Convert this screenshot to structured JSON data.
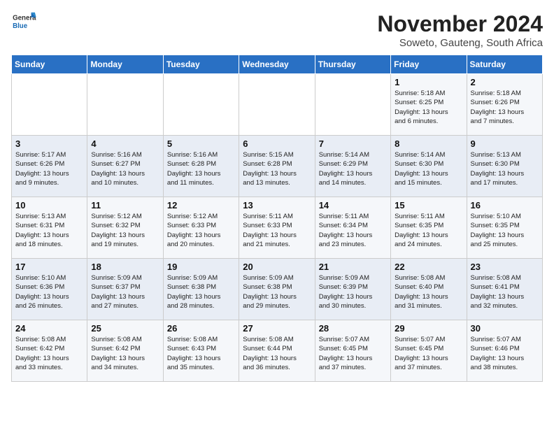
{
  "app": {
    "name": "GeneralBlue",
    "logo_text_1": "General",
    "logo_text_2": "Blue"
  },
  "calendar": {
    "month_title": "November 2024",
    "subtitle": "Soweto, Gauteng, South Africa",
    "days_of_week": [
      "Sunday",
      "Monday",
      "Tuesday",
      "Wednesday",
      "Thursday",
      "Friday",
      "Saturday"
    ],
    "weeks": [
      [
        {
          "day": "",
          "info": ""
        },
        {
          "day": "",
          "info": ""
        },
        {
          "day": "",
          "info": ""
        },
        {
          "day": "",
          "info": ""
        },
        {
          "day": "",
          "info": ""
        },
        {
          "day": "1",
          "info": "Sunrise: 5:18 AM\nSunset: 6:25 PM\nDaylight: 13 hours\nand 6 minutes."
        },
        {
          "day": "2",
          "info": "Sunrise: 5:18 AM\nSunset: 6:26 PM\nDaylight: 13 hours\nand 7 minutes."
        }
      ],
      [
        {
          "day": "3",
          "info": "Sunrise: 5:17 AM\nSunset: 6:26 PM\nDaylight: 13 hours\nand 9 minutes."
        },
        {
          "day": "4",
          "info": "Sunrise: 5:16 AM\nSunset: 6:27 PM\nDaylight: 13 hours\nand 10 minutes."
        },
        {
          "day": "5",
          "info": "Sunrise: 5:16 AM\nSunset: 6:28 PM\nDaylight: 13 hours\nand 11 minutes."
        },
        {
          "day": "6",
          "info": "Sunrise: 5:15 AM\nSunset: 6:28 PM\nDaylight: 13 hours\nand 13 minutes."
        },
        {
          "day": "7",
          "info": "Sunrise: 5:14 AM\nSunset: 6:29 PM\nDaylight: 13 hours\nand 14 minutes."
        },
        {
          "day": "8",
          "info": "Sunrise: 5:14 AM\nSunset: 6:30 PM\nDaylight: 13 hours\nand 15 minutes."
        },
        {
          "day": "9",
          "info": "Sunrise: 5:13 AM\nSunset: 6:30 PM\nDaylight: 13 hours\nand 17 minutes."
        }
      ],
      [
        {
          "day": "10",
          "info": "Sunrise: 5:13 AM\nSunset: 6:31 PM\nDaylight: 13 hours\nand 18 minutes."
        },
        {
          "day": "11",
          "info": "Sunrise: 5:12 AM\nSunset: 6:32 PM\nDaylight: 13 hours\nand 19 minutes."
        },
        {
          "day": "12",
          "info": "Sunrise: 5:12 AM\nSunset: 6:33 PM\nDaylight: 13 hours\nand 20 minutes."
        },
        {
          "day": "13",
          "info": "Sunrise: 5:11 AM\nSunset: 6:33 PM\nDaylight: 13 hours\nand 21 minutes."
        },
        {
          "day": "14",
          "info": "Sunrise: 5:11 AM\nSunset: 6:34 PM\nDaylight: 13 hours\nand 23 minutes."
        },
        {
          "day": "15",
          "info": "Sunrise: 5:11 AM\nSunset: 6:35 PM\nDaylight: 13 hours\nand 24 minutes."
        },
        {
          "day": "16",
          "info": "Sunrise: 5:10 AM\nSunset: 6:35 PM\nDaylight: 13 hours\nand 25 minutes."
        }
      ],
      [
        {
          "day": "17",
          "info": "Sunrise: 5:10 AM\nSunset: 6:36 PM\nDaylight: 13 hours\nand 26 minutes."
        },
        {
          "day": "18",
          "info": "Sunrise: 5:09 AM\nSunset: 6:37 PM\nDaylight: 13 hours\nand 27 minutes."
        },
        {
          "day": "19",
          "info": "Sunrise: 5:09 AM\nSunset: 6:38 PM\nDaylight: 13 hours\nand 28 minutes."
        },
        {
          "day": "20",
          "info": "Sunrise: 5:09 AM\nSunset: 6:38 PM\nDaylight: 13 hours\nand 29 minutes."
        },
        {
          "day": "21",
          "info": "Sunrise: 5:09 AM\nSunset: 6:39 PM\nDaylight: 13 hours\nand 30 minutes."
        },
        {
          "day": "22",
          "info": "Sunrise: 5:08 AM\nSunset: 6:40 PM\nDaylight: 13 hours\nand 31 minutes."
        },
        {
          "day": "23",
          "info": "Sunrise: 5:08 AM\nSunset: 6:41 PM\nDaylight: 13 hours\nand 32 minutes."
        }
      ],
      [
        {
          "day": "24",
          "info": "Sunrise: 5:08 AM\nSunset: 6:42 PM\nDaylight: 13 hours\nand 33 minutes."
        },
        {
          "day": "25",
          "info": "Sunrise: 5:08 AM\nSunset: 6:42 PM\nDaylight: 13 hours\nand 34 minutes."
        },
        {
          "day": "26",
          "info": "Sunrise: 5:08 AM\nSunset: 6:43 PM\nDaylight: 13 hours\nand 35 minutes."
        },
        {
          "day": "27",
          "info": "Sunrise: 5:08 AM\nSunset: 6:44 PM\nDaylight: 13 hours\nand 36 minutes."
        },
        {
          "day": "28",
          "info": "Sunrise: 5:07 AM\nSunset: 6:45 PM\nDaylight: 13 hours\nand 37 minutes."
        },
        {
          "day": "29",
          "info": "Sunrise: 5:07 AM\nSunset: 6:45 PM\nDaylight: 13 hours\nand 37 minutes."
        },
        {
          "day": "30",
          "info": "Sunrise: 5:07 AM\nSunset: 6:46 PM\nDaylight: 13 hours\nand 38 minutes."
        }
      ]
    ]
  }
}
